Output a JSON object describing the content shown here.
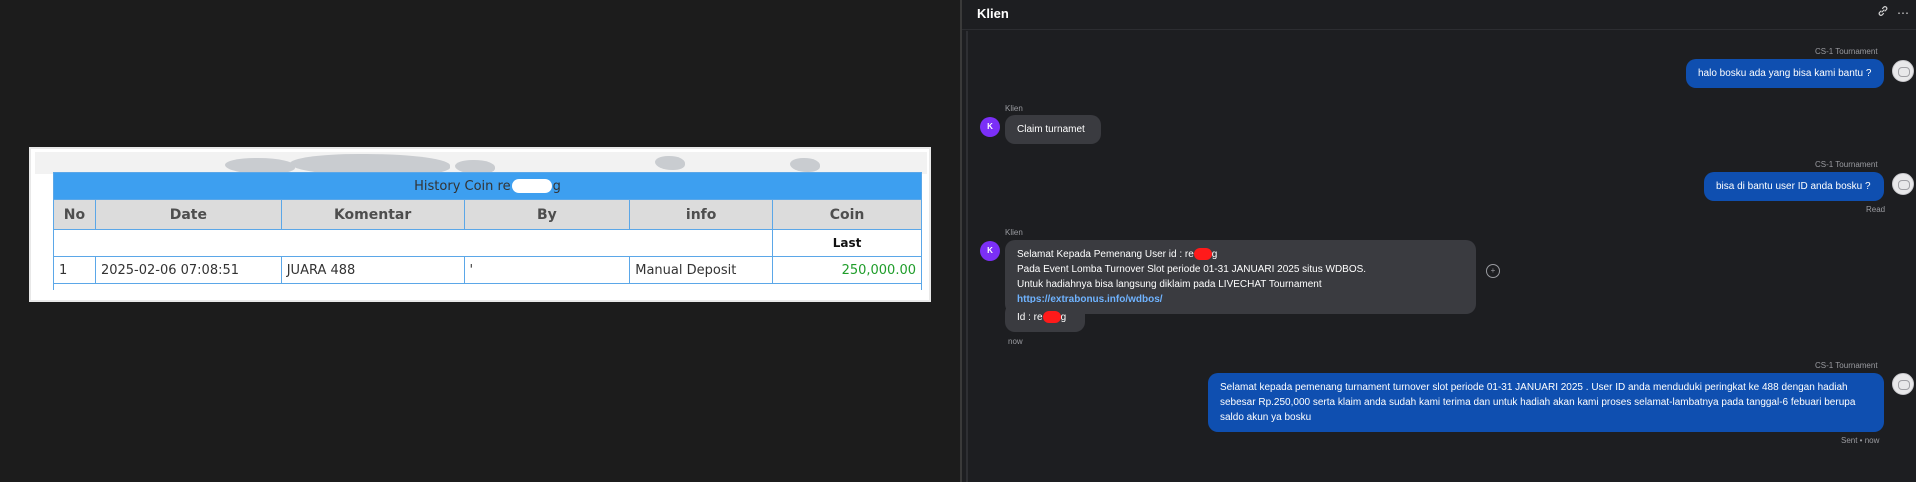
{
  "history": {
    "title_prefix": "History Coin re",
    "title_suffix": "g",
    "columns": [
      "No",
      "Date",
      "Komentar",
      "By",
      "info",
      "Coin"
    ],
    "last_label": "Last",
    "rows": [
      {
        "no": "1",
        "date": "2025-02-06 07:08:51",
        "komentar": "JUARA 488",
        "by": "'",
        "info": "Manual Deposit",
        "coin": "250,000.00"
      }
    ],
    "coin_color": "#1f9d2a",
    "header_color": "#3d9ff0"
  },
  "chat": {
    "title": "Klien",
    "header_icons": [
      "link-icon",
      "more-icon"
    ],
    "messages": [
      {
        "id": "m1",
        "sender": "CS-1 Tournament",
        "direction": "out",
        "text": "halo bosku ada yang bisa kami bantu ?"
      },
      {
        "id": "m2",
        "sender": "Klien",
        "direction": "in",
        "avatar": "K",
        "text": "Claim turnamet"
      },
      {
        "id": "m3",
        "sender": "CS-1 Tournament",
        "direction": "out",
        "text": "bisa di bantu user ID anda bosku ?",
        "status": "Read"
      },
      {
        "id": "m4",
        "sender": "Klien",
        "direction": "in",
        "avatar": "K",
        "line1_prefix": "Selamat Kepada Pemenang User id : re",
        "line1_suffix": "g",
        "line2": "Pada Event Lomba Turnover Slot periode 01-31 JANUARI 2025 situs WDBOS.",
        "line3": "Untuk hadiahnya bisa langsung diklaim pada LIVECHAT Tournament ",
        "link": "https://extrabonus.info/wdbos/"
      },
      {
        "id": "m5",
        "sender": "Klien",
        "direction": "in",
        "text_prefix": "Id : re",
        "text_suffix": "g",
        "time": "now"
      },
      {
        "id": "m6",
        "sender": "CS-1 Tournament",
        "direction": "out",
        "text": "Selamat kepada pemenang turnament turnover slot periode 01-31 JANUARI 2025 . User ID anda menduduki peringkat ke 488 dengan hadiah sebesar Rp.250,000 serta klaim anda sudah kami terima dan untuk hadiah akan kami proses selamat-lambatnya pada tanggal-6 febuari berupa saldo akun ya bosku",
        "status": "Sent • now"
      }
    ],
    "colors": {
      "outgoing": "#0f4fb0",
      "incoming": "#3a3b40",
      "avatar": "#7b2ff7",
      "link": "#6fb3ff"
    }
  }
}
